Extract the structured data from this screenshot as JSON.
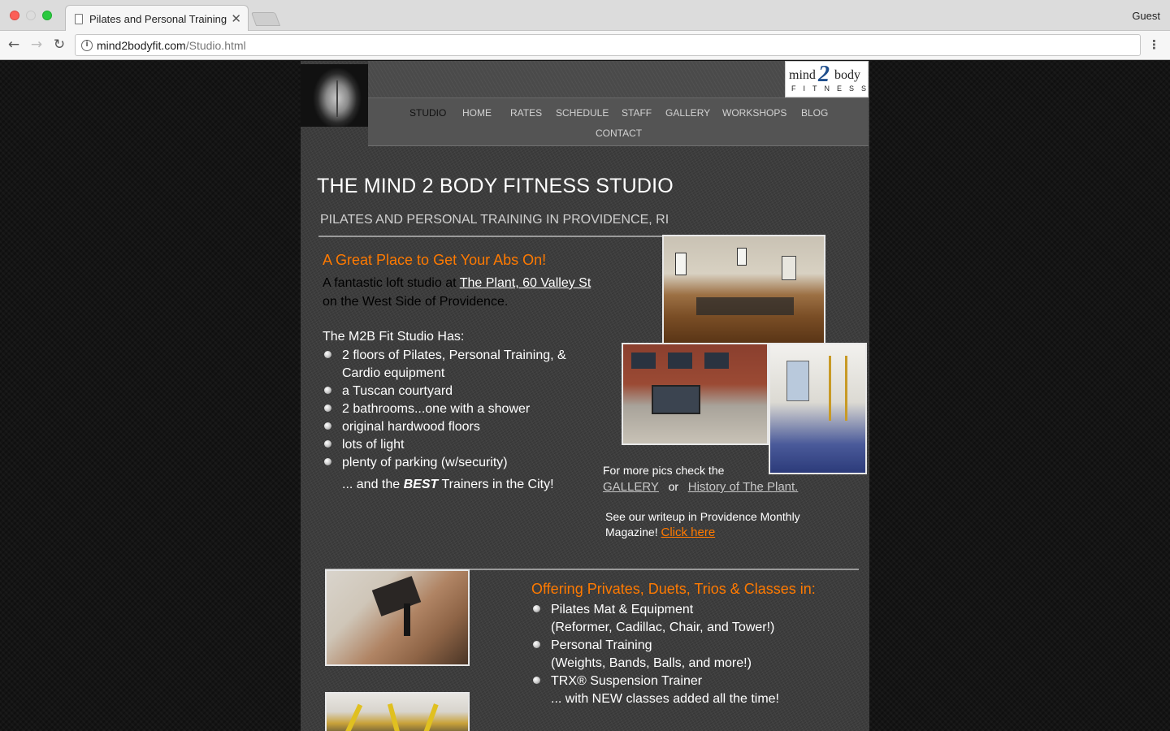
{
  "browser": {
    "tab_title": "Pilates and Personal Training in Providence",
    "tab_close": "✕",
    "profile": "Guest",
    "url_host": "mind2bodyfit.com",
    "url_path": "/Studio.html",
    "back": "←",
    "forward": "→",
    "reload": "↻",
    "menu": "⋮",
    "info": "i"
  },
  "logo": {
    "mind": "mind",
    "two": "2",
    "body": "body",
    "fitness": "FITNESS"
  },
  "nav": {
    "items": [
      "STUDIO",
      "HOME",
      "RATES",
      "SCHEDULE",
      "STAFF",
      "GALLERY",
      "WORKSHOPS",
      "BLOG",
      "CONTACT"
    ],
    "active": "STUDIO"
  },
  "main": {
    "title": "THE MIND 2 BODY FITNESS STUDIO",
    "subtitle": "PILATES AND PERSONAL TRAINING IN PROVIDENCE, RI",
    "promo_heading": "A Great Place to Get Your Abs On!",
    "intro_before": "A fantastic loft studio at ",
    "intro_link": "The Plant, 60 Valley St",
    "intro_after": " on the West Side of Providence.",
    "has_label": "The M2B Fit Studio Has:",
    "features": [
      "2 floors of Pilates, Personal Training, & Cardio equipment",
      "a Tuscan courtyard",
      "2 bathrooms...one with a shower",
      "original hardwood floors",
      "lots of light",
      "plenty of parking (w/security)"
    ],
    "best_before": "... and the ",
    "best_emph": "BEST",
    "best_after": " Trainers in the City!",
    "more_pics_text": "For more pics check the",
    "gallery_link": "GALLERY",
    "or_text": "or",
    "history_link": "History of The Plant.",
    "writeup_line1": "See our writeup in Providence Monthly",
    "writeup_line2": "Magazine!",
    "writeup_link": "Click here",
    "services_heading": "Offering Privates, Duets, Trios & Classes in:",
    "services": [
      {
        "name": "Pilates Mat & Equipment",
        "detail": "(Reformer, Cadillac, Chair, and Tower!)"
      },
      {
        "name": "Personal Training",
        "detail": "(Weights, Bands, Balls, and more!)"
      },
      {
        "name": "TRX® Suspension Trainer",
        "detail": ""
      }
    ],
    "tagline": "... with NEW classes added all the time!"
  },
  "colors": {
    "accent": "#ff7a00",
    "content_bg": "#3e3e3e",
    "page_bg": "#141414"
  }
}
